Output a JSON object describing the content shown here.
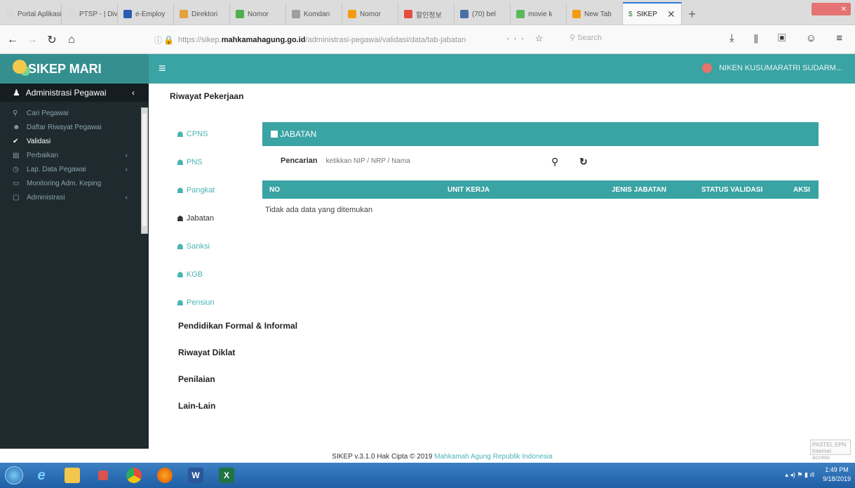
{
  "browser": {
    "tabs": [
      {
        "label": "Portal Aplikasi",
        "color": "#d9d9d9"
      },
      {
        "label": "PTSP - | Divisi",
        "color": "#d9d9d9"
      },
      {
        "label": "e-Employ",
        "color": "#2a5db0"
      },
      {
        "label": "Direktori",
        "color": "#e6a23c"
      },
      {
        "label": "Nomor",
        "color": "#4caf50"
      },
      {
        "label": "Komdan",
        "color": "#9e9e9e"
      },
      {
        "label": "Nomor",
        "color": "#f39c12"
      },
      {
        "label": "할인정보",
        "color": "#e74c3c"
      },
      {
        "label": "(70) bel",
        "color": "#4a6fa5"
      },
      {
        "label": "movie k",
        "color": "#5cb85c"
      },
      {
        "label": "New Tab",
        "color": "#f39c12"
      }
    ],
    "active_tab": {
      "label": "SIKEP",
      "icon": "dollar-icon"
    },
    "url_prefix": "https://sikep.",
    "url_domain": "mahkamahagung.go.id",
    "url_path": "/administrasi-pegawai/validasi/data/tab-jabatan",
    "page_actions": "··· ☆",
    "search_placeholder": "Search",
    "toolbar_icons": "⤓ ⦀ ▣ ☺ ≡"
  },
  "app": {
    "brand": "SIKEP MARI",
    "menu_icon": "≡",
    "user_name": "NIKEN KUSUMARATRI SUDARM..."
  },
  "sidebar": {
    "header": "Administrasi Pegawai",
    "items": [
      {
        "label": "Cari Pegawai",
        "icon": "search-icon",
        "glyph": "⚲"
      },
      {
        "label": "Daftar Riwayat Pegawai",
        "icon": "users-icon",
        "glyph": "☻"
      },
      {
        "label": "Validasi",
        "icon": "check-icon",
        "glyph": "✔"
      },
      {
        "label": "Perbaikan",
        "icon": "table-icon",
        "glyph": "▤"
      },
      {
        "label": "Lap. Data Pegawai",
        "icon": "chart-icon",
        "glyph": "◷"
      },
      {
        "label": "Monitoring Adm. Keping",
        "icon": "monitor-icon",
        "glyph": "▭"
      },
      {
        "label": "Administrasi",
        "icon": "folder-icon",
        "glyph": "▢"
      }
    ]
  },
  "main": {
    "title": "Riwayat Pekerjaan",
    "subnav": [
      {
        "label": "CPNS"
      },
      {
        "label": "PNS"
      },
      {
        "label": "Pangkat"
      },
      {
        "label": "Jabatan"
      },
      {
        "label": "Sanksi"
      },
      {
        "label": "KGB"
      },
      {
        "label": "Pensiun"
      }
    ],
    "panel_title": "JABATAN",
    "search_label": "Pencarian",
    "search_placeholder": "ketikkan NIP / NRP / Nama",
    "columns": [
      "NO",
      "UNIT KERJA",
      "JENIS JABATAN",
      "STATUS VALIDASI",
      "AKSI"
    ],
    "empty_message": "Tidak ada data yang ditemukan",
    "sections": [
      "Pendidikan Formal & Informal",
      "Riwayat Diklat",
      "Penilaian",
      "Lain-Lain"
    ]
  },
  "footer": {
    "text": "SIKEP v.3.1.0 Hak Cipta © 2019 ",
    "link": "Mahkamah Agung Republik Indonesia"
  },
  "badge": "PASTEL EPN Internet access",
  "taskbar": {
    "time": "1:49 PM",
    "date": "9/18/2019"
  }
}
